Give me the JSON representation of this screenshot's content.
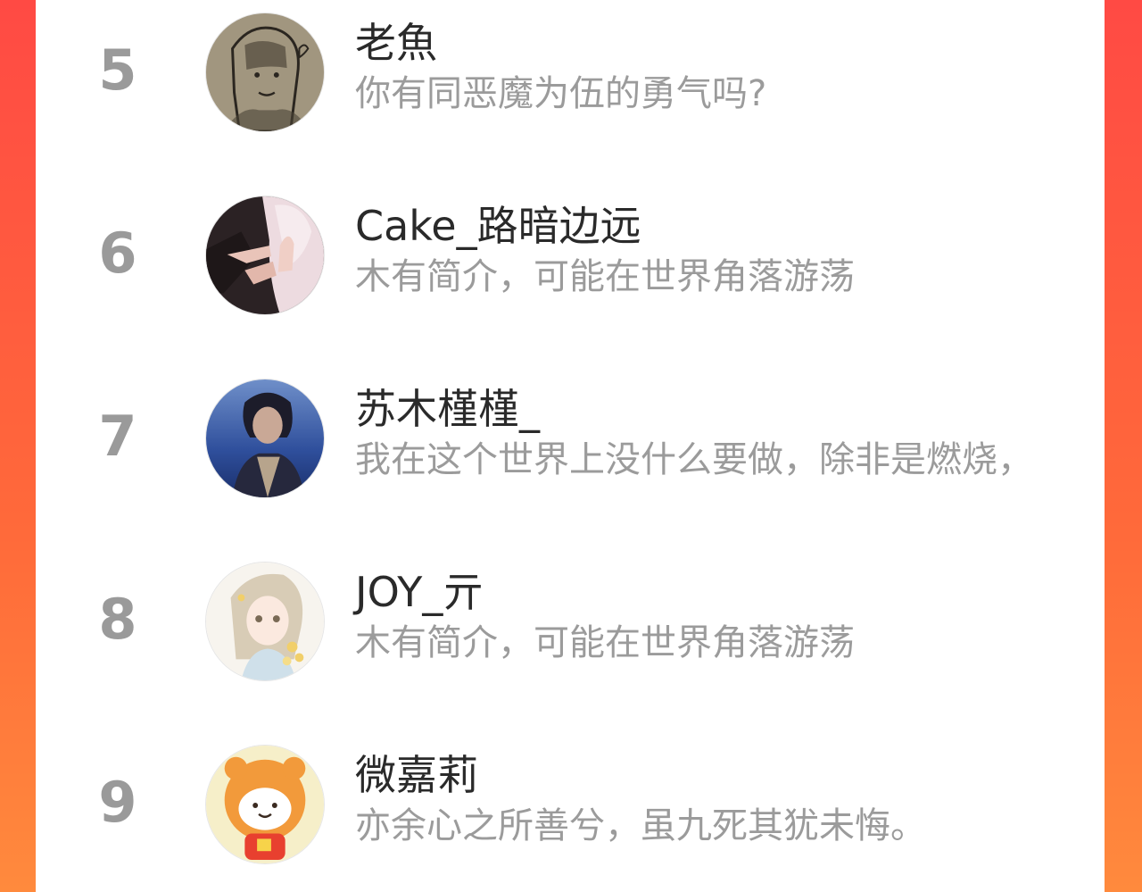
{
  "colors": {
    "frame_top": "#ff4a44",
    "frame_bottom": "#ff8a3d",
    "rank_text": "#9a9a9a",
    "name_text": "#2a2a2a",
    "bio_text": "#9b9b9b"
  },
  "ranking": {
    "items": [
      {
        "rank": "5",
        "name": "老魚",
        "bio": "你有同恶魔为伍的勇气吗?",
        "avatar": "sketch-avatar"
      },
      {
        "rank": "6",
        "name": "Cake_路暗边远",
        "bio": "木有简介，可能在世界角落游荡",
        "avatar": "hands-avatar"
      },
      {
        "rank": "7",
        "name": "苏木槿槿_",
        "bio": "我在这个世界上没什么要做，除非是燃烧，",
        "avatar": "blue-portrait-avatar"
      },
      {
        "rank": "8",
        "name": "JOY_亓",
        "bio": "木有简介，可能在世界角落游荡",
        "avatar": "anime-girl-avatar"
      },
      {
        "rank": "9",
        "name": "微嘉莉",
        "bio": "亦余心之所善兮，虽九死其犹未悔。",
        "avatar": "tiger-cartoon-avatar"
      }
    ]
  }
}
